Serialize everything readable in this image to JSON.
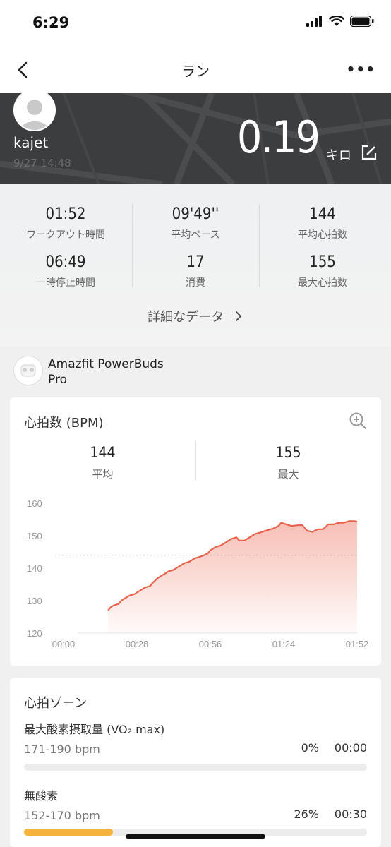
{
  "status_bar": {
    "time": "6:29"
  },
  "nav": {
    "title": "ラン"
  },
  "hero": {
    "username": "kajet",
    "datetime": "9/27 14:48",
    "distance": "0.19",
    "unit": "キロ"
  },
  "stats": [
    {
      "value": "01:52",
      "label": "ワークアウト時間"
    },
    {
      "value": "09'49''",
      "label": "平均ペース"
    },
    {
      "value": "144",
      "label": "平均心拍数"
    },
    {
      "value": "06:49",
      "label": "一時停止時間"
    },
    {
      "value": "17",
      "label": "消費"
    },
    {
      "value": "155",
      "label": "最大心拍数"
    }
  ],
  "details_link": "詳細なデータ",
  "device": {
    "name_line1": "Amazfit PowerBuds",
    "name_line2": "Pro"
  },
  "heart_rate": {
    "title": "心拍数 (BPM)",
    "avg_value": "144",
    "avg_label": "平均",
    "max_value": "155",
    "max_label": "最大",
    "color": "#e8634d"
  },
  "chart_data": {
    "type": "area",
    "title": "",
    "xlabel": "",
    "ylabel": "",
    "x_ticks": [
      "00:00",
      "00:28",
      "00:56",
      "01:24",
      "01:52"
    ],
    "y_ticks": [
      120,
      130,
      140,
      150,
      160
    ],
    "ylim": [
      120,
      160
    ],
    "xlim_seconds": [
      0,
      112
    ],
    "average_line": 144,
    "series": [
      {
        "x": [
          17,
          18,
          19,
          21,
          22,
          23,
          25,
          27,
          28,
          30,
          31,
          33,
          34,
          36,
          37,
          39,
          40,
          42,
          43,
          45,
          46,
          48,
          50,
          52,
          53,
          55,
          56,
          58,
          60,
          61,
          62,
          64,
          66,
          67,
          69,
          71,
          73,
          75,
          77,
          79,
          80,
          82,
          83,
          85,
          87,
          89,
          91,
          93,
          95,
          97,
          99,
          101,
          103,
          105,
          107,
          109,
          111,
          112
        ],
        "y": [
          127,
          128,
          128.5,
          129,
          130,
          130.5,
          131.5,
          132,
          132.5,
          133.5,
          134,
          134.5,
          135.5,
          137,
          137.5,
          138.5,
          139,
          139.5,
          140,
          141,
          141.5,
          142,
          143,
          143.5,
          143.8,
          144.5,
          145.5,
          146.5,
          147,
          147.5,
          148,
          149,
          149.5,
          148.5,
          148.5,
          149.5,
          150.5,
          151,
          151.5,
          152,
          152.2,
          153,
          154,
          153.5,
          153,
          153.2,
          153.3,
          151.5,
          151.2,
          152,
          152,
          153.5,
          153.5,
          154,
          154,
          154.5,
          154.5,
          154.3
        ]
      }
    ]
  },
  "zones": {
    "title": "心拍ゾーン",
    "items": [
      {
        "name": "最大酸素摂取量 (VO₂ max)",
        "range": "171-190 bpm",
        "percent": "0%",
        "time": "00:00",
        "fraction": 0,
        "color": "#f5b33b"
      },
      {
        "name": "無酸素",
        "range": "152-170 bpm",
        "percent": "26%",
        "time": "00:30",
        "fraction": 0.26,
        "color": "#f5b33b"
      }
    ]
  }
}
